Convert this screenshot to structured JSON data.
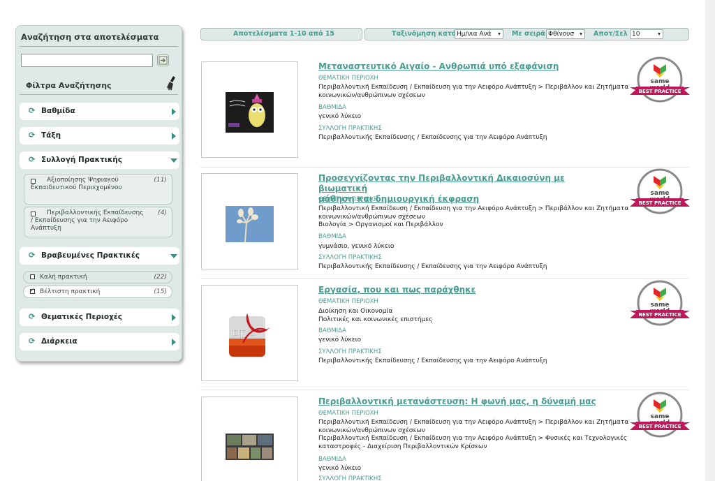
{
  "sidebar": {
    "title": "Αναζήτηση στα αποτελέσματα",
    "search_placeholder": "",
    "filters_title": "Φίλτρα Αναζήτησης",
    "facets": [
      {
        "label": "Βαθμίδα",
        "expanded": false
      },
      {
        "label": "Τάξη",
        "expanded": false
      },
      {
        "label": "Συλλογή Πρακτικής",
        "expanded": true
      },
      {
        "label": "Βραβευμένες Πρακτικές",
        "expanded": true
      },
      {
        "label": "Θεματικές Περιοχές",
        "expanded": false
      },
      {
        "label": "Διάρκεια",
        "expanded": false
      }
    ],
    "collection_options": [
      {
        "line1": "Αξιοποίησης Ψηφιακού",
        "line2": "Εκπαιδευτικού Περιεχομένου",
        "line3": "",
        "count": "(11)",
        "checked": false
      },
      {
        "line1": "Περιβαλλοντικής Εκπαίδευσης",
        "line2": "/ Εκπαίδευσης για την Αειφόρο",
        "line3": "Ανάπτυξη",
        "count": "(4)",
        "checked": false
      }
    ],
    "award_options": [
      {
        "label": "Καλή πρακτική",
        "count": "(22)",
        "checked": false
      },
      {
        "label": "Βέλτιστη πρακτική",
        "count": "(15)",
        "checked": true
      }
    ]
  },
  "toolbar": {
    "results_text": "Αποτελέσματα 1-10 από 15",
    "sort_label": "Ταξινόμηση κατά",
    "sort_value": "Ημ/νια Ανά",
    "order_label": "Με σειρά",
    "order_value": "Φθίνουσ",
    "per_page_label": "Αποτ/Σελ",
    "per_page_value": "10"
  },
  "badge": {
    "line1": "same",
    "line2": "world",
    "ribbon": "BEST PRACTICE",
    "colors": {
      "ring": "#888888",
      "ribbon": "#c2185b",
      "logo_red": "#e4262b",
      "logo_yellow": "#f2c400",
      "logo_green": "#3fae49"
    }
  },
  "labels": {
    "thematic": "ΘΕΜΑΤΙΚΗ ΠΕΡΙΟΧΗ",
    "level": "ΒΑΘΜΙΔΑ",
    "collection": "ΣΥΛΛΟΓΗ ΠΡΑΚΤΙΚΗΣ"
  },
  "results": [
    {
      "title": "Μεταναστευτικό Αιγαίο - Ανθρωπιά υπό εξαφάνιση",
      "thumb": "owl-drawing-icon",
      "thematic": [
        "Περιβαλλοντική Εκπαίδευση / Εκπαίδευση για την Αειφόρο Ανάπτυξη > Περιβάλλον και Ζητήματα",
        "κοινωνικών/ανθρώπινων σχέσεων"
      ],
      "level": "γενικό λύκειο",
      "collection": "Περιβαλλοντικής Εκπαίδευσης / Εκπαίδευσης για την Αειφόρο Ανάπτυξη"
    },
    {
      "title_line1": "Προσεγγίζοντας την Περιβαλλοντική Δικαιοσύνη με βιωματική",
      "title_line2": "μάθηση και δημιουργική έκφραση",
      "thumb": "plant-photo-icon",
      "thematic": [
        "Περιβαλλοντική Εκπαίδευση / Εκπαίδευση για την Αειφόρο Ανάπτυξη > Περιβάλλον και Ζητήματα",
        "κοινωνικών/ανθρώπινων σχέσεων",
        "Βιολογία > Οργανισμοί και Περιβάλλον"
      ],
      "level": "γυμνάσιο, γενικό λύκειο",
      "collection": "Περιβαλλοντικής Εκπαίδευσης / Εκπαίδευσης για την Αειφόρο Ανάπτυξη"
    },
    {
      "title": "Εργασία, που και πως παράχθηκε",
      "thumb": "pdf-file-icon",
      "thematic": [
        "Διοίκηση και Οικονομία",
        "Πολιτικές και κοινωνικές επιστήμες"
      ],
      "level": "γενικό λύκειο",
      "collection": "Περιβαλλοντικής Εκπαίδευσης / Εκπαίδευσης για την Αειφόρο Ανάπτυξη"
    },
    {
      "title": "Περιβαλλοντική μετανάστευση: Η φωνή μας, η δύναμή μας",
      "thumb": "photo-collage-icon",
      "thematic": [
        "Περιβαλλοντική Εκπαίδευση / Εκπαίδευση για την Αειφόρο Ανάπτυξη > Περιβάλλον και Ζητήματα",
        "κοινωνικών/ανθρώπινων σχέσεων",
        "Περιβαλλοντική Εκπαίδευση / Εκπαίδευση για την Αειφόρο Ανάπτυξη > Φυσικές και Τεχνολογικές",
        "καταστροφές - Διαχείριση Περιβαλλοντικών Κρίσεων"
      ],
      "level": "γενικό λύκειο",
      "collection": ""
    }
  ]
}
